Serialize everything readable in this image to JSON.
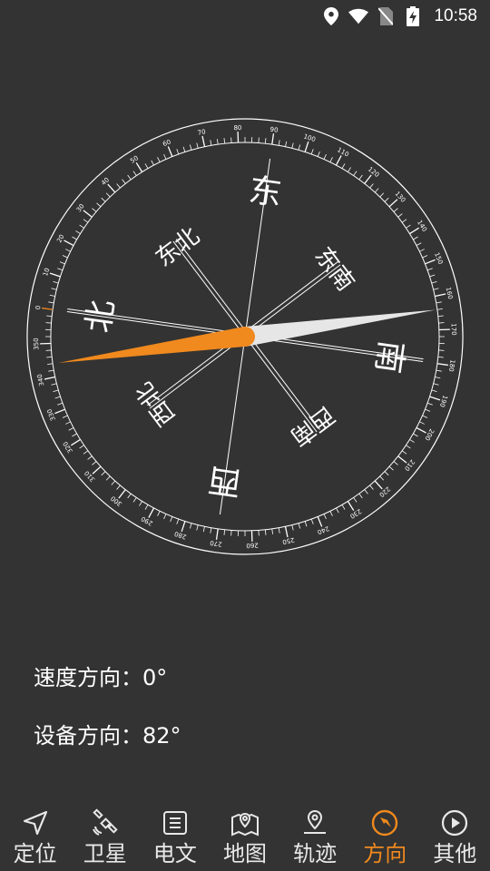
{
  "status_bar": {
    "time": "10:58"
  },
  "compass": {
    "directions": {
      "north": "北",
      "east": "东",
      "south": "南",
      "west": "西",
      "northeast": "东北",
      "southeast": "东南",
      "southwest": "西南",
      "northwest": "西北"
    },
    "heading_degrees": 82,
    "accent_color": "#f0891e"
  },
  "info": {
    "speed_direction": "速度方向：0°",
    "device_direction": "设备方向：82°"
  },
  "bottom_nav": {
    "items": [
      {
        "label": "定位",
        "icon": "navigation-arrow-icon"
      },
      {
        "label": "卫星",
        "icon": "satellite-icon"
      },
      {
        "label": "电文",
        "icon": "document-icon"
      },
      {
        "label": "地图",
        "icon": "map-pin-icon"
      },
      {
        "label": "轨迹",
        "icon": "track-pin-icon"
      },
      {
        "label": "方向",
        "icon": "compass-icon",
        "active": true
      },
      {
        "label": "其他",
        "icon": "play-circle-icon"
      }
    ]
  }
}
